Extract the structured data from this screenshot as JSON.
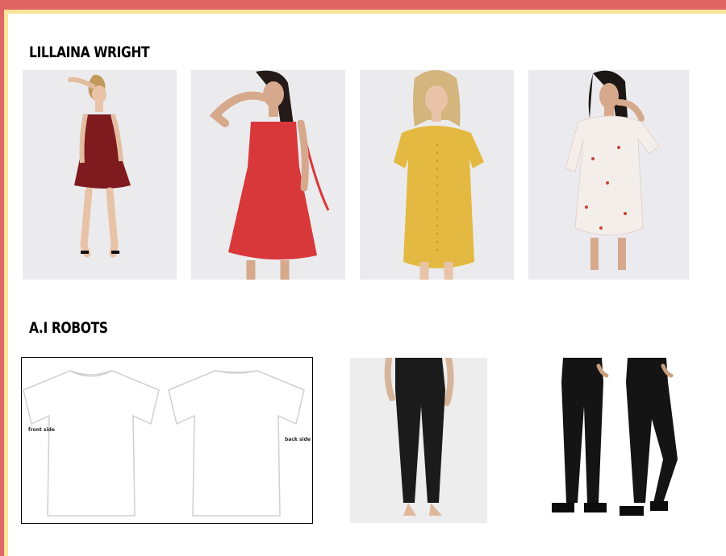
{
  "sections": [
    {
      "heading": "LILLAINA WRIGHT",
      "items": [
        {
          "name": "red-polka-wrap-dress",
          "color": "#7f1a1e"
        },
        {
          "name": "red-floral-slip-dress",
          "color": "#d9383b"
        },
        {
          "name": "yellow-floral-button-dress",
          "color": "#e3b941"
        },
        {
          "name": "white-floral-wrap-dress",
          "color": "#f4eeea"
        }
      ]
    },
    {
      "heading": "A.I ROBOTS",
      "items": [
        {
          "name": "white-tshirt-front-back",
          "front_label": "front side",
          "back_label": "back side"
        },
        {
          "name": "black-leggings",
          "color": "#1b1b1b"
        },
        {
          "name": "black-jeans",
          "color": "#141414"
        }
      ]
    }
  ],
  "colors": {
    "border_red": "#e06666",
    "border_yellow": "#ffe599",
    "photo_bg": "#ececec"
  }
}
